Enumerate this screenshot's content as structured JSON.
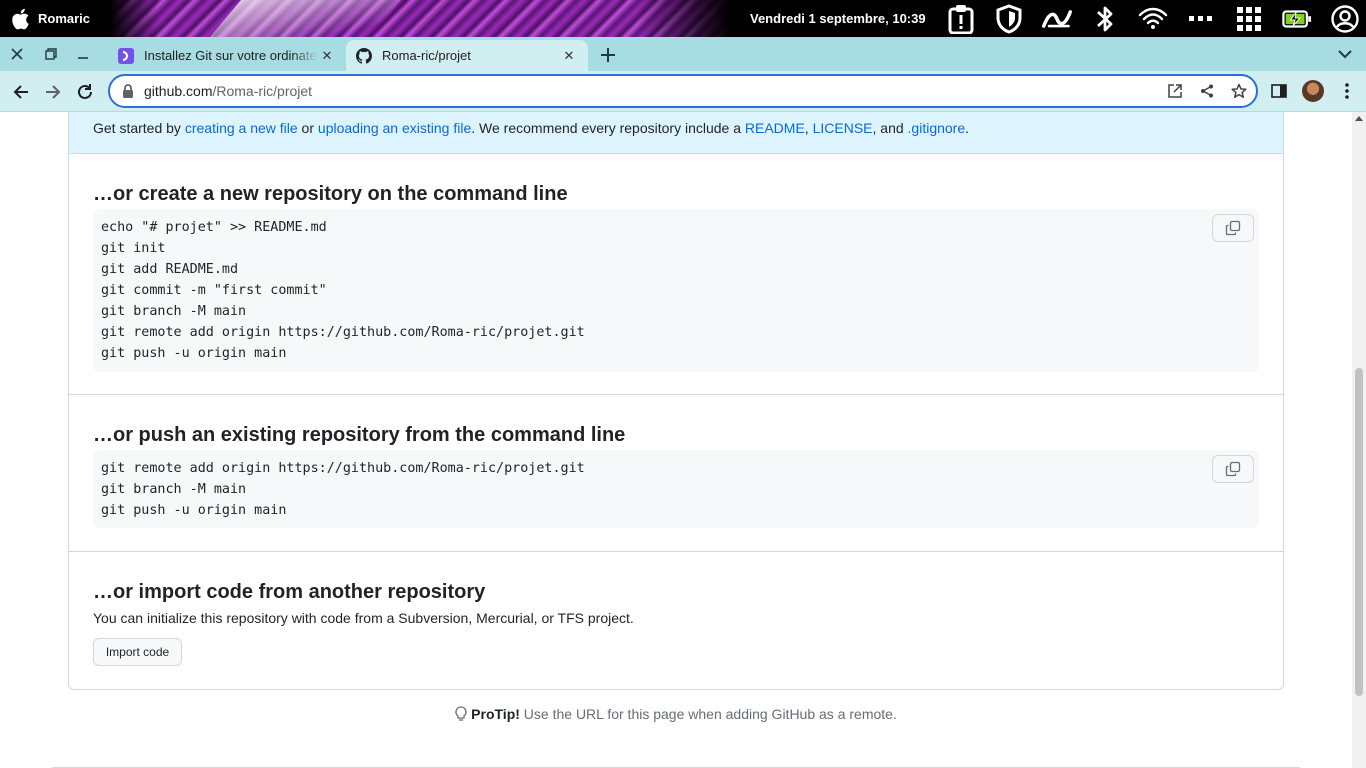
{
  "os": {
    "user": "Romaric",
    "clock": "Vendredi  1 septembre, 10:39",
    "tray_icons": [
      "clipboard-icon",
      "shield-icon",
      "cloud-sync-icon",
      "bluetooth-icon",
      "wifi-icon",
      "more-dots-icon",
      "apps-grid-icon",
      "battery-charging-icon",
      "account-icon"
    ]
  },
  "tabs": [
    {
      "title": "Installez Git sur votre ordinateur",
      "favicon": "openclassrooms-icon",
      "active": false
    },
    {
      "title": "Roma-ric/projet",
      "favicon": "github-icon",
      "active": true
    }
  ],
  "toolbar": {
    "url_host": "github.com",
    "url_path": "/Roma-ric/projet"
  },
  "quick_setup": {
    "text_1": "Get started by ",
    "link_new_file": "creating a new file",
    "text_2": " or ",
    "link_upload": "uploading an existing file",
    "text_3": ". We recommend every repository include a ",
    "link_readme": "README",
    "text_4": ", ",
    "link_license": "LICENSE",
    "text_5": ", and ",
    "link_gitignore": ".gitignore",
    "text_6": "."
  },
  "sections": {
    "new_repo": {
      "heading": "…or create a new repository on the command line",
      "code": "echo \"# projet\" >> README.md\ngit init\ngit add README.md\ngit commit -m \"first commit\"\ngit branch -M main\ngit remote add origin https://github.com/Roma-ric/projet.git\ngit push -u origin main"
    },
    "push_existing": {
      "heading": "…or push an existing repository from the command line",
      "code": "git remote add origin https://github.com/Roma-ric/projet.git\ngit branch -M main\ngit push -u origin main"
    },
    "import": {
      "heading": "…or import code from another repository",
      "description": "You can initialize this repository with code from a Subversion, Mercurial, or TFS project.",
      "button": "Import code"
    }
  },
  "protip": {
    "label": "ProTip!",
    "text": " Use the URL for this page when adding GitHub as a remote."
  },
  "colors": {
    "link": "#0969da",
    "accent_tab": "#a8dce3",
    "quick_setup_bg": "#ddf4ff"
  }
}
